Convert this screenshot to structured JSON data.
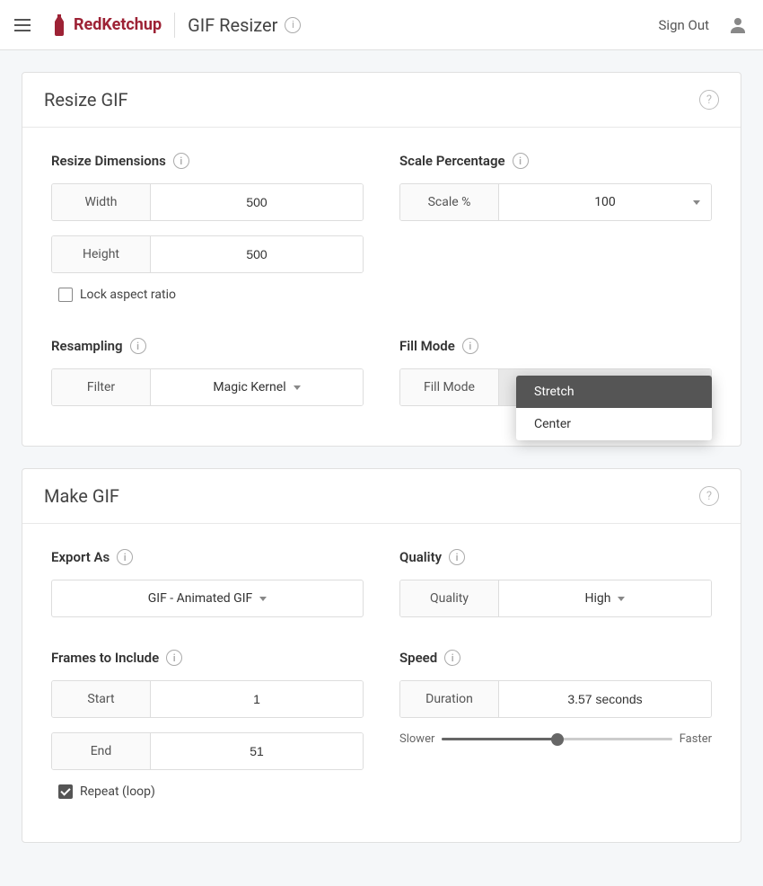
{
  "header": {
    "brand": "RedKetchup",
    "page_title": "GIF Resizer",
    "sign_out": "Sign Out"
  },
  "resize": {
    "card_title": "Resize GIF",
    "dimensions_label": "Resize Dimensions",
    "width_label": "Width",
    "width_value": "500",
    "height_label": "Height",
    "height_value": "500",
    "lock_aspect_label": "Lock aspect ratio",
    "scale_label": "Scale Percentage",
    "scale_input_label": "Scale %",
    "scale_value": "100",
    "resampling_label": "Resampling",
    "filter_label": "Filter",
    "filter_value": "Magic Kernel",
    "fillmode_label": "Fill Mode",
    "fillmode_input_label": "Fill Mode",
    "fillmode_value": "Stretch",
    "fillmode_options": {
      "0": "Stretch",
      "1": "Center"
    }
  },
  "make": {
    "card_title": "Make GIF",
    "export_label": "Export As",
    "export_value": "GIF - Animated GIF",
    "frames_label": "Frames to Include",
    "start_label": "Start",
    "start_value": "1",
    "end_label": "End",
    "end_value": "51",
    "repeat_label": "Repeat (loop)",
    "quality_label": "Quality",
    "quality_input_label": "Quality",
    "quality_value": "High",
    "speed_label": "Speed",
    "duration_label": "Duration",
    "duration_value": "3.57 seconds",
    "slower_label": "Slower",
    "faster_label": "Faster",
    "speed_percent": 50
  }
}
